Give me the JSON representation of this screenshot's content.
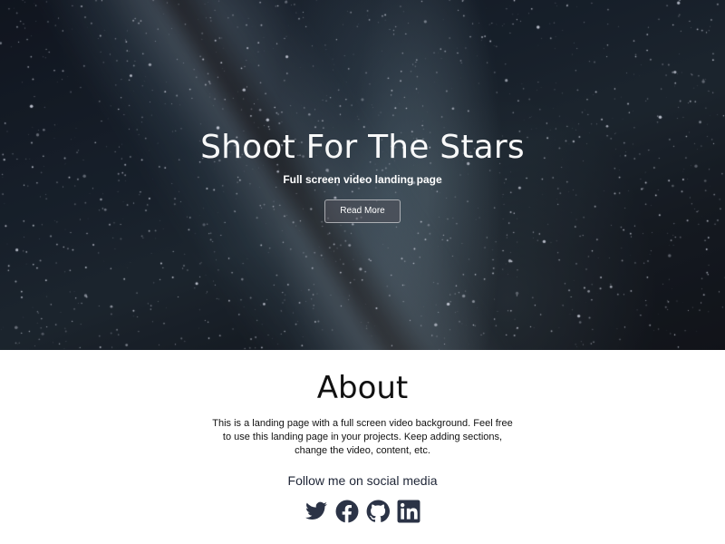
{
  "hero": {
    "title": "Shoot For The Stars",
    "subtitle": "Full screen video landing page",
    "button_label": "Read More"
  },
  "about": {
    "title": "About",
    "text": "This is a landing page with a full screen video background. Feel free to use this landing page in your projects. Keep adding sections, change the video, content, etc.",
    "social_heading": "Follow me on social media",
    "social_links": [
      {
        "icon": "twitter-icon"
      },
      {
        "icon": "facebook-icon"
      },
      {
        "icon": "github-icon"
      },
      {
        "icon": "linkedin-icon"
      }
    ]
  },
  "colors": {
    "icon_color": "#2b3346",
    "text_dark": "#111111"
  }
}
